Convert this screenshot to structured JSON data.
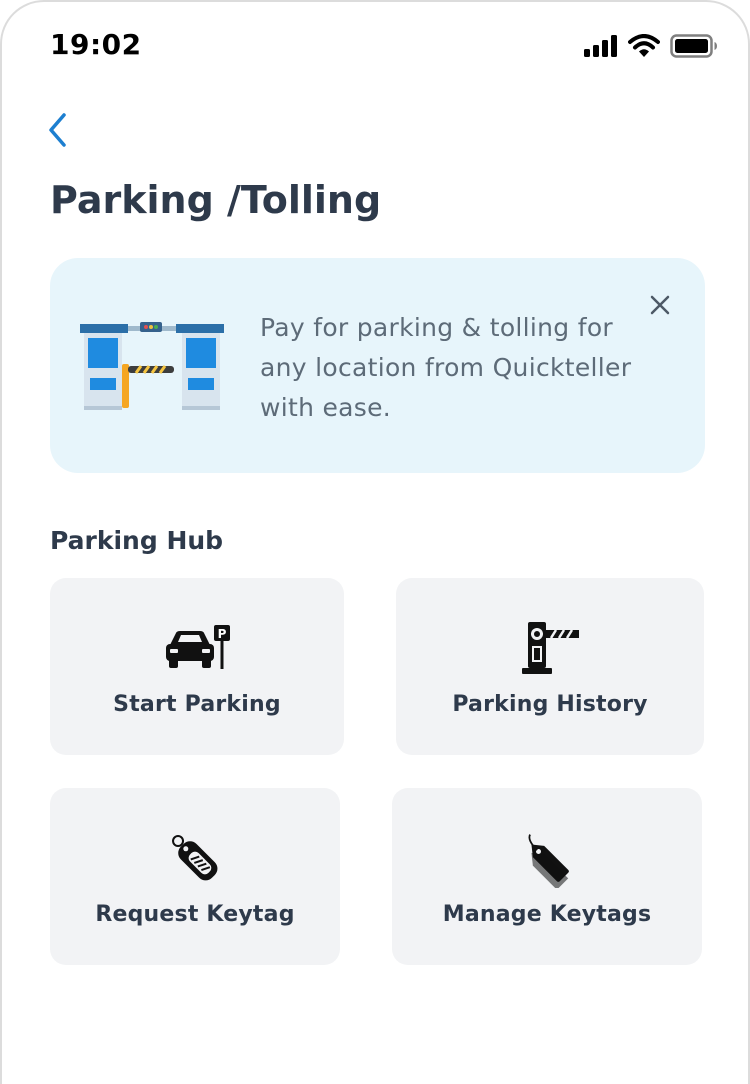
{
  "status_bar": {
    "time": "19:02",
    "icons": [
      "cellular-signal-icon",
      "wifi-icon",
      "battery-icon"
    ]
  },
  "header": {
    "back_icon": "chevron-left-icon",
    "title": "Parking /Tolling"
  },
  "banner": {
    "text": "Pay for parking & tolling for any location from Quickteller with ease.",
    "illustration": "toll-gate-illustration",
    "close_icon": "close-icon",
    "background_color": "#e7f5fb"
  },
  "hub": {
    "title": "Parking Hub",
    "tiles": [
      {
        "label": "Start Parking",
        "icon": "car-parking-icon"
      },
      {
        "label": "Parking History",
        "icon": "toll-barrier-icon"
      },
      {
        "label": "Request Keytag",
        "icon": "keytag-icon"
      },
      {
        "label": "Manage Keytags",
        "icon": "tag-icon"
      }
    ]
  },
  "colors": {
    "accent": "#1d7fd0",
    "title_text": "#2e3a4b",
    "body_text": "#5d6b78",
    "tile_background": "#f2f3f5"
  }
}
